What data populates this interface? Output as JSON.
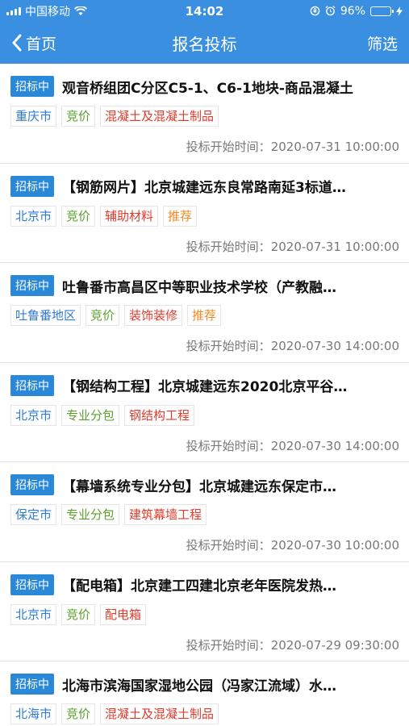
{
  "status_bar": {
    "carrier": "中国移动",
    "time": "14:02",
    "battery": "96%",
    "battery_level": 0.96
  },
  "nav": {
    "back_label": "首页",
    "title": "报名投标",
    "filter_label": "筛选"
  },
  "colors": {
    "primary": "#3a8fe0",
    "badge": "#2a88d8",
    "city": "#2f7bd2",
    "method": "#5aa02c",
    "category": "#e23a2a",
    "recommend": "#f08a24"
  },
  "time_label": "投标开始时间：",
  "items": [
    {
      "status": "招标中",
      "title": "观音桥组团C分区C5-1、C6-1地块-商品混凝土",
      "city": "重庆市",
      "method": "竞价",
      "category": "混凝土及混凝土制品",
      "recommend": "",
      "start_time": "2020-07-31 10:00:00"
    },
    {
      "status": "招标中",
      "title": "【钢筋网片】北京城建远东良常路南延3标道…",
      "city": "北京市",
      "method": "竞价",
      "category": "辅助材料",
      "recommend": "推荐",
      "start_time": "2020-07-31 10:00:00"
    },
    {
      "status": "招标中",
      "title": "吐鲁番市高昌区中等职业技术学校（产教融…",
      "city": "吐鲁番地区",
      "method": "竞价",
      "category": "装饰装修",
      "recommend": "推荐",
      "start_time": "2020-07-30 14:00:00"
    },
    {
      "status": "招标中",
      "title": "【钢结构工程】北京城建远东2020北京平谷…",
      "city": "北京市",
      "method": "专业分包",
      "category": "钢结构工程",
      "recommend": "",
      "start_time": "2020-07-30 14:00:00"
    },
    {
      "status": "招标中",
      "title": "【幕墙系统专业分包】北京城建远东保定市…",
      "city": "保定市",
      "method": "专业分包",
      "category": "建筑幕墙工程",
      "recommend": "",
      "start_time": "2020-07-30 10:00:00"
    },
    {
      "status": "招标中",
      "title": "【配电箱】北京建工四建北京老年医院发热…",
      "city": "北京市",
      "method": "竞价",
      "category": "配电箱",
      "recommend": "",
      "start_time": "2020-07-29 09:30:00"
    },
    {
      "status": "招标中",
      "title": "北海市滨海国家湿地公园（冯家江流域）水…",
      "city": "北海市",
      "method": "竞价",
      "category": "混凝土及混凝土制品",
      "recommend": "",
      "start_time": ""
    }
  ]
}
